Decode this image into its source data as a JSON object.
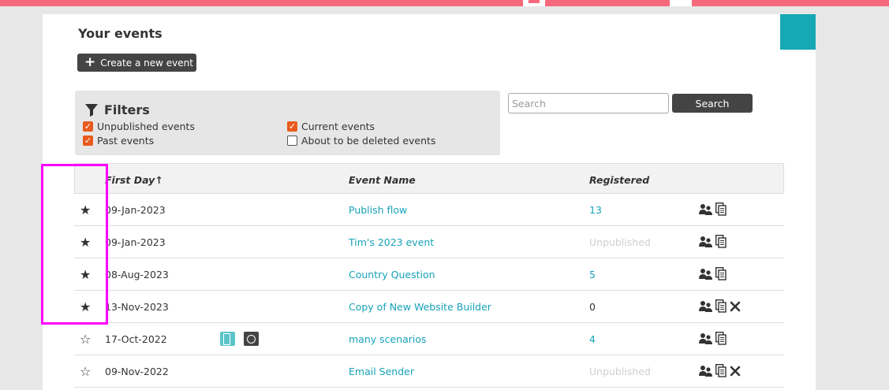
{
  "page": {
    "title": "Your events"
  },
  "toolbar": {
    "create_label": "Create a new event"
  },
  "filters": {
    "title": "Filters",
    "options": [
      {
        "label": "Unpublished events",
        "checked": true
      },
      {
        "label": "Current events",
        "checked": true
      },
      {
        "label": "Past events",
        "checked": true
      },
      {
        "label": "About to be deleted events",
        "checked": false
      }
    ]
  },
  "search": {
    "placeholder": "Search",
    "button_label": "Search"
  },
  "table": {
    "headers": {
      "first_day": "First Day↑",
      "event_name": "Event Name",
      "registered": "Registered"
    },
    "rows": [
      {
        "star": "★",
        "date": "09-Jan-2023",
        "name": "Publish flow",
        "registered": "13",
        "registered_style": "link",
        "deletable": false,
        "badges": false
      },
      {
        "star": "★",
        "date": "09-Jan-2023",
        "name": "Tim's 2023 event",
        "registered": "Unpublished",
        "registered_style": "muted",
        "deletable": false,
        "badges": false
      },
      {
        "star": "★",
        "date": "08-Aug-2023",
        "name": "Country Question",
        "registered": "5",
        "registered_style": "link",
        "deletable": false,
        "badges": false
      },
      {
        "star": "★",
        "date": "13-Nov-2023",
        "name": "Copy of New Website Builder",
        "registered": "0",
        "registered_style": "plain",
        "deletable": true,
        "badges": false
      },
      {
        "star": "☆",
        "date": "17-Oct-2022",
        "name": "many scenarios",
        "registered": "4",
        "registered_style": "link",
        "deletable": false,
        "badges": true
      },
      {
        "star": "☆",
        "date": "09-Nov-2022",
        "name": "Email Sender",
        "registered": "Unpublished",
        "registered_style": "muted",
        "deletable": true,
        "badges": false
      }
    ]
  },
  "icons": {
    "attendees": "attendees-icon",
    "copy": "copy-icon",
    "delete": "delete-icon",
    "filter": "filter-icon",
    "plus": "plus-icon",
    "page_badge": "page-badge-icon",
    "website_badge": "website-badge-icon"
  },
  "colors": {
    "accent_teal": "#17a2b8",
    "top_bar": "#f56a7a",
    "checkbox": "#e85a1d",
    "highlight": "#ff00ff",
    "dark_button": "#444444"
  }
}
